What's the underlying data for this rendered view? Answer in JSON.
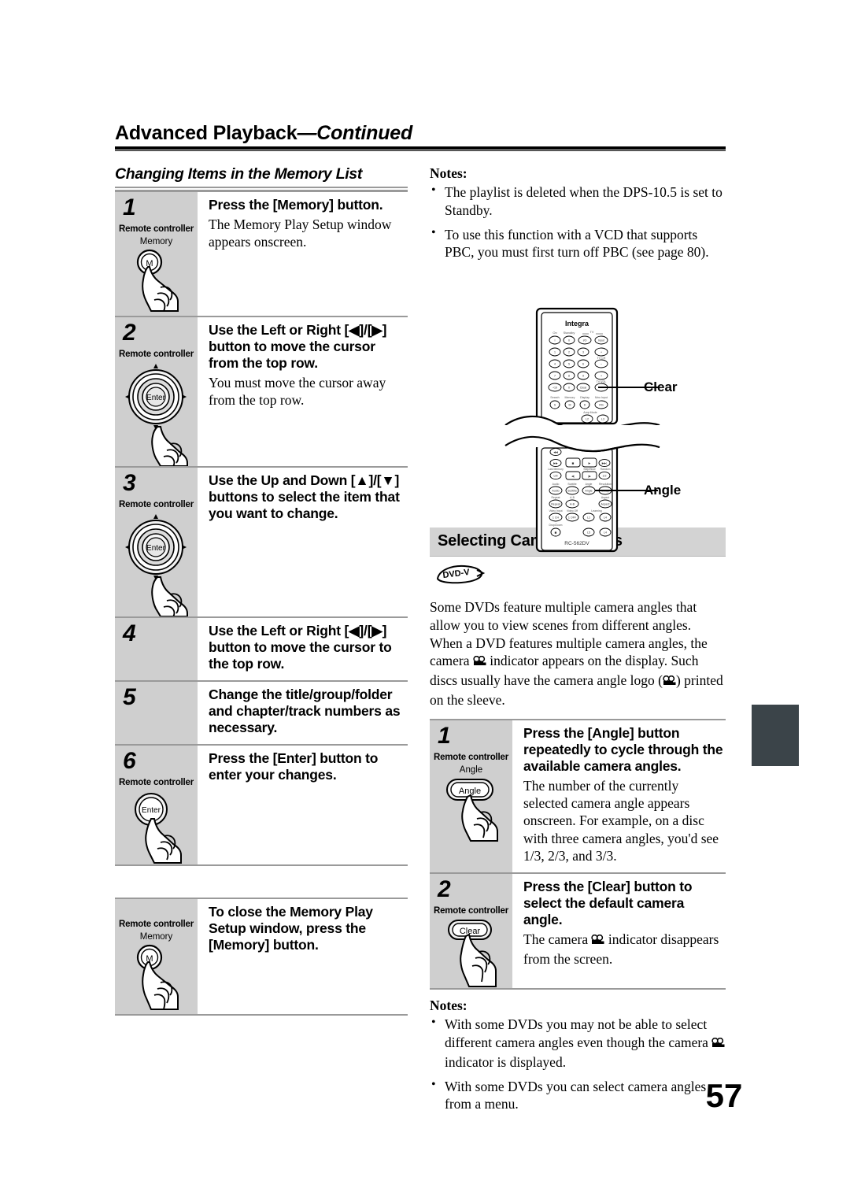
{
  "page": {
    "number": "57",
    "running_head": "Advanced Playback",
    "running_head_suffix": "—Continued"
  },
  "left_column": {
    "section_title": "Changing Items in the Memory List",
    "steps": [
      {
        "number": "1",
        "device_label": "Remote controller",
        "button_caption": "Memory",
        "button_glyph": "M",
        "title": "Press the [Memory] button.",
        "description": "The Memory Play Setup window appears onscreen."
      },
      {
        "number": "2",
        "device_label": "Remote controller",
        "button_caption": "",
        "button_glyph": "Enter",
        "title": "Use the Left or Right [◀]/[▶] button to move the cursor from the top row.",
        "description": "You must move the cursor away from the top row."
      },
      {
        "number": "3",
        "device_label": "Remote controller",
        "button_caption": "",
        "button_glyph": "Enter",
        "title": "Use the Up and Down [▲]/[▼] buttons to select the item that you want to change.",
        "description": ""
      },
      {
        "number": "4",
        "device_label": "",
        "button_caption": "",
        "button_glyph": "",
        "title": "Use the Left or Right [◀]/[▶] button to move the cursor to the top row.",
        "description": ""
      },
      {
        "number": "5",
        "device_label": "",
        "button_caption": "",
        "button_glyph": "",
        "title": "Change the title/group/folder and chapter/track numbers as necessary.",
        "description": ""
      },
      {
        "number": "6",
        "device_label": "Remote controller",
        "button_caption": "",
        "button_glyph": "Enter",
        "title": "Press the [Enter] button to enter your changes.",
        "description": ""
      }
    ],
    "closing_step": {
      "device_label": "Remote controller",
      "button_caption": "Memory",
      "button_glyph": "M",
      "title": "To close the Memory Play Setup window, press the [Memory] button."
    }
  },
  "right_column": {
    "notes_top": {
      "label": "Notes:",
      "items": [
        "The playlist is deleted when the DPS-10.5 is set to Standby.",
        "To use this function with a VCD that supports PBC, you must first turn off PBC (see page 80)."
      ]
    },
    "remote": {
      "brand": "Integra",
      "model": "RC-562DV",
      "callouts": [
        {
          "label": "Clear"
        },
        {
          "label": "Angle"
        }
      ]
    },
    "section_title": "Selecting Camera Angles",
    "disc_logo": "DVD-V",
    "intro_paragraph_part1": "Some DVDs feature multiple camera angles that allow you to view scenes from different angles. When a DVD features multiple camera angles, the camera ",
    "intro_paragraph_part2": " indicator appears on the display. Such discs usually have the camera angle logo (",
    "intro_paragraph_part3": ") printed on the sleeve.",
    "steps": [
      {
        "number": "1",
        "device_label": "Remote controller",
        "button_caption": "Angle",
        "button_glyph": "Angle",
        "title": "Press the [Angle] button repeatedly to cycle through the available camera angles.",
        "description": "The number of the currently selected camera angle appears onscreen. For example, on a disc with three camera angles, you'd see 1/3, 2/3, and 3/3."
      },
      {
        "number": "2",
        "device_label": "Remote controller",
        "button_caption": "",
        "button_glyph": "Clear",
        "title": "Press the [Clear] button to select the default camera angle.",
        "description_part1": "The camera ",
        "description_part2": " indicator disappears from the screen."
      }
    ],
    "notes_bottom": {
      "label": "Notes:",
      "item1_part1": "With some DVDs you may not be able to select different camera angles even though the camera ",
      "item1_part2": " indicator is displayed.",
      "item2": "With some DVDs you can select camera angles from a menu."
    }
  },
  "colors": {
    "cell_gray": "#cfcfcf",
    "bar_gray": "#d3d3d3",
    "rule_gray": "#9a9a9a",
    "edge_tab": "#3b4449"
  }
}
